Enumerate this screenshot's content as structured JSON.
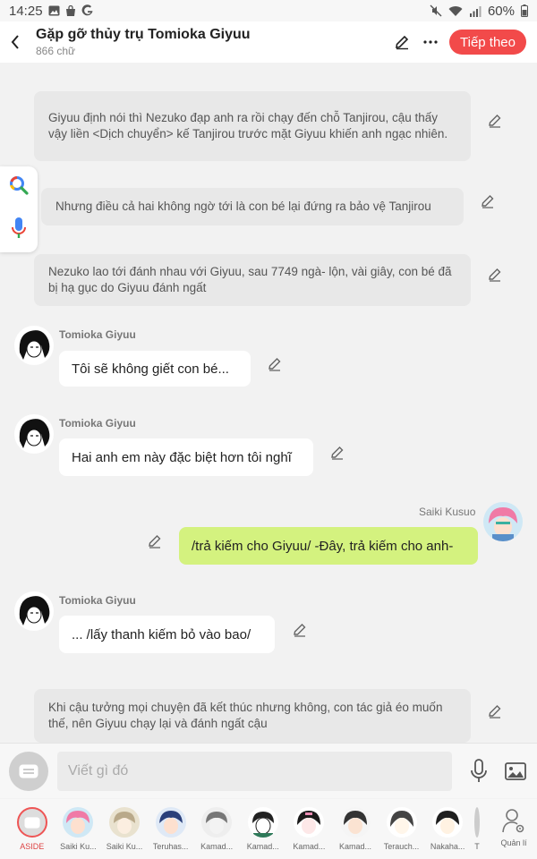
{
  "status_bar": {
    "time": "14:25",
    "battery": "60%"
  },
  "header": {
    "title": "Gặp gỡ thủy trụ Tomioka Giyuu",
    "word_count": "866 chữ",
    "next_label": "Tiếp theo"
  },
  "messages": {
    "n1": "Giyuu định nói thì Nezuko đạp anh ra rồi chạy đến chỗ Tanjirou, cậu thấy vậy liền <Dịch chuyển> kế Tanjirou trước mặt Giyuu khiến anh ngạc nhiên.",
    "n2": "Nhưng điều cả hai không ngờ tới là con bé lại đứng ra bảo vệ Tanjirou",
    "n3": "Nezuko lao tới đánh nhau với Giyuu, sau 7749 ngà- lộn, vài giây, con bé đã bị hạ gục do Giyuu đánh ngất",
    "s1_name": "Tomioka Giyuu",
    "s1_text": "Tôi sẽ không giết con bé...",
    "s2_name": "Tomioka Giyuu",
    "s2_text": "Hai anh em này đặc biệt hơn tôi nghĩ",
    "s3_name": "Saiki Kusuo",
    "s3_text": "/trả kiếm cho Giyuu/ -Đây, trả kiếm cho anh-",
    "s4_name": "Tomioka Giyuu",
    "s4_text": "... /lấy thanh kiếm bỏ vào bao/",
    "n4": "Khi cậu tưởng mọi chuyện đã kết thúc nhưng không, con tác giả éo muốn thế, nên Giyuu chạy lại và đánh ngất cậu"
  },
  "input": {
    "placeholder": "Viết gì đó"
  },
  "characters": [
    {
      "name": "ASIDE"
    },
    {
      "name": "Saiki Ku..."
    },
    {
      "name": "Saiki Ku..."
    },
    {
      "name": "Teruhas..."
    },
    {
      "name": "Kamad..."
    },
    {
      "name": "Kamad..."
    },
    {
      "name": "Kamad..."
    },
    {
      "name": "Kamad..."
    },
    {
      "name": "Terauch..."
    },
    {
      "name": "Nakaha..."
    },
    {
      "name": "T"
    }
  ],
  "manage_label": "Quản lí",
  "colors": {
    "accent": "#f24a4a",
    "my_bubble": "#d4f27f",
    "narration_bg": "#e8e8e8"
  }
}
